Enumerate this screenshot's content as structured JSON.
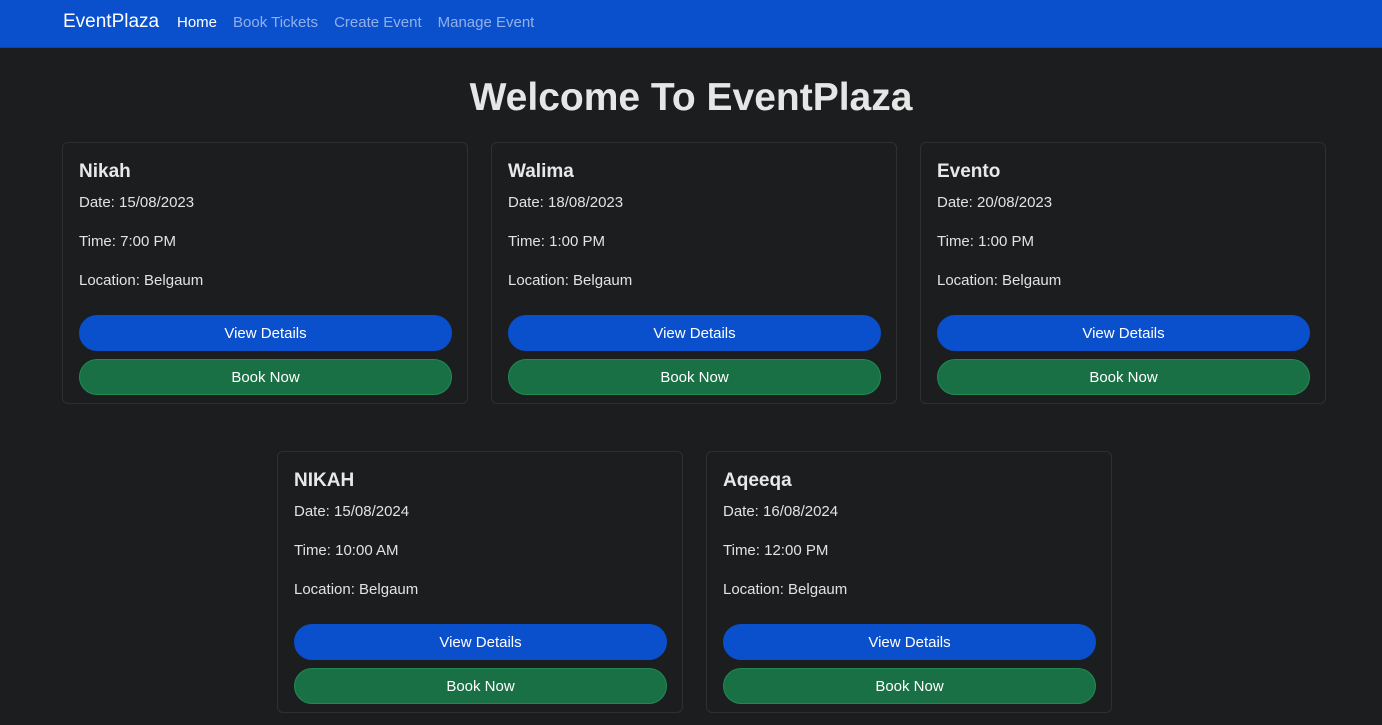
{
  "navbar": {
    "brand": "EventPlaza",
    "links": [
      {
        "label": "Home",
        "active": true
      },
      {
        "label": "Book Tickets",
        "active": false
      },
      {
        "label": "Create Event",
        "active": false
      },
      {
        "label": "Manage Event",
        "active": false
      }
    ]
  },
  "page": {
    "title": "Welcome To EventPlaza"
  },
  "labels": {
    "date_prefix": "Date: ",
    "time_prefix": "Time: ",
    "location_prefix": "Location: ",
    "view_details": "View Details",
    "book_now": "Book Now"
  },
  "events": [
    {
      "name": "Nikah",
      "date": "15/08/2023",
      "time": "7:00 PM",
      "location": "Belgaum"
    },
    {
      "name": "Walima",
      "date": "18/08/2023",
      "time": "1:00 PM",
      "location": "Belgaum"
    },
    {
      "name": "Evento",
      "date": "20/08/2023",
      "time": "1:00 PM",
      "location": "Belgaum"
    },
    {
      "name": "NIKAH",
      "date": "15/08/2024",
      "time": "10:00 AM",
      "location": "Belgaum"
    },
    {
      "name": "Aqeeqa",
      "date": "16/08/2024",
      "time": "12:00 PM",
      "location": "Belgaum"
    }
  ],
  "colors": {
    "primary": "#0a4fcc",
    "success": "#1a7045",
    "background": "#1b1d1f"
  }
}
